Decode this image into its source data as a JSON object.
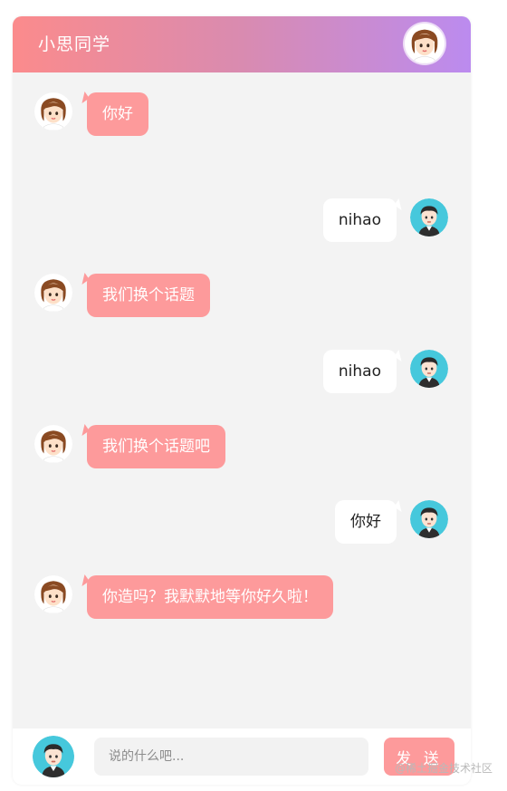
{
  "header": {
    "title": "小思同学",
    "avatar_icon": "girl-avatar-icon"
  },
  "messages": [
    {
      "from": "bot",
      "text": "你好"
    },
    {
      "from": "user",
      "text": "nihao"
    },
    {
      "from": "bot",
      "text": "我们换个话题"
    },
    {
      "from": "user",
      "text": "nihao"
    },
    {
      "from": "bot",
      "text": "我们换个话题吧"
    },
    {
      "from": "user",
      "text": "你好"
    },
    {
      "from": "bot",
      "text": "你造吗？我默默地等你好久啦！"
    }
  ],
  "footer": {
    "avatar_icon": "boy-avatar-icon",
    "input_placeholder": "说的什么吧...",
    "input_value": "",
    "send_label": "发 送"
  },
  "watermark": "@稀土掘金技术社区",
  "colors": {
    "header_gradient_start": "#fb8b8c",
    "header_gradient_end": "#bb8bef",
    "bot_bubble": "#fd9a9b",
    "user_bubble": "#ffffff",
    "chat_background": "#f3f3f3",
    "send_button": "#fd9a9b"
  }
}
